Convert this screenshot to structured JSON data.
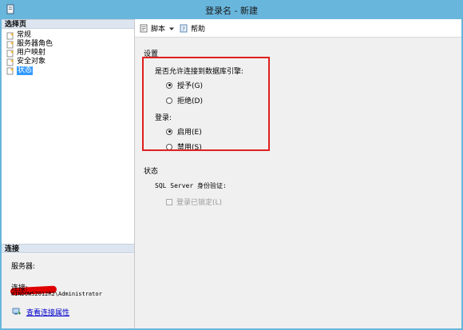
{
  "window": {
    "title": "登录名 - 新建"
  },
  "left_pane": {
    "select_page_header": "选择页",
    "nav_items": [
      {
        "label": "常规",
        "icon": "page-icon",
        "selected": false
      },
      {
        "label": "服务器角色",
        "icon": "page-icon",
        "selected": false
      },
      {
        "label": "用户映射",
        "icon": "page-icon",
        "selected": false
      },
      {
        "label": "安全对象",
        "icon": "page-icon",
        "selected": false
      },
      {
        "label": "状态",
        "icon": "page-icon",
        "selected": true
      }
    ],
    "connection_header": "连接",
    "server_label": "服务器:",
    "connection_label": "连接:",
    "connection_value": "WINDOWS2012R2\\Administrator",
    "view_connection_properties_link": "查看连接属性"
  },
  "toolbar": {
    "script_label": "脚本",
    "help_label": "帮助"
  },
  "settings": {
    "group_title": "设置",
    "permission_label": "是否允许连接到数据库引擎:",
    "grant_label": "授予(G)",
    "deny_label": "拒绝(D)",
    "login_label": "登录:",
    "enabled_label": "启用(E)",
    "disabled_label": "禁用(S)",
    "permission_value": "grant",
    "login_value": "enabled"
  },
  "status": {
    "group_title": "状态",
    "auth_label": "SQL Server 身份验证:",
    "locked_label": "登录已锁定(L)",
    "locked_checked": false
  },
  "colors": {
    "title_bar": "#69b6dd",
    "highlight_box": "#e02020",
    "selected_item": "#3399ff",
    "link": "#0000cc"
  }
}
